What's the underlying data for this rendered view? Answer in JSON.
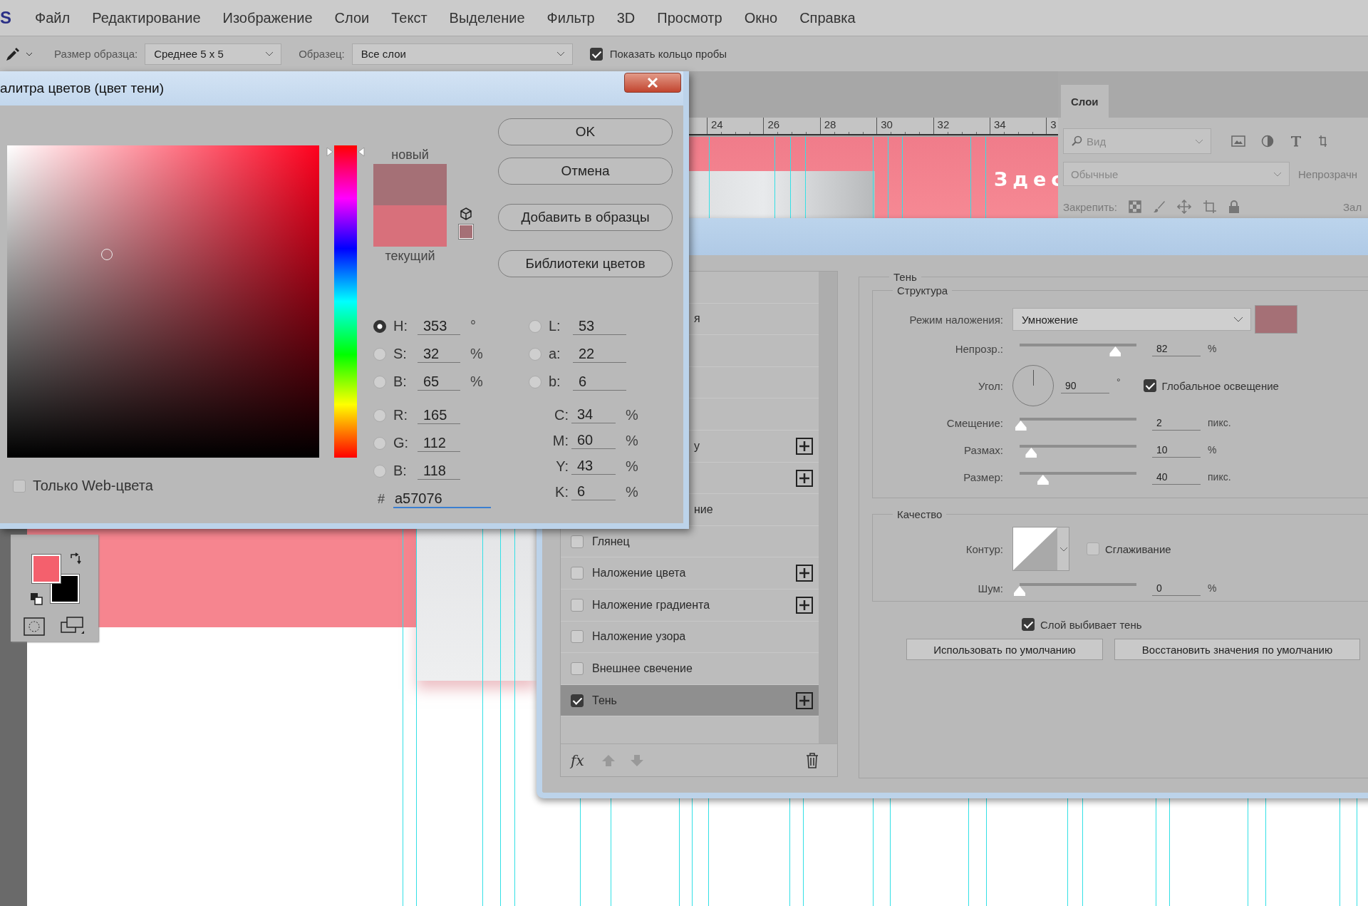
{
  "menu_bar": {
    "logo": "S",
    "items": [
      "Файл",
      "Редактирование",
      "Изображение",
      "Слои",
      "Текст",
      "Выделение",
      "Фильтр",
      "3D",
      "Просмотр",
      "Окно",
      "Справка"
    ]
  },
  "options_bar": {
    "sample_size_label": "Размер образца:",
    "sample_size": "Среднее 5 x 5",
    "sample_label": "Образец:",
    "sample": "Все слои",
    "sample_ring": {
      "label": "Показать кольцо пробы",
      "checked": true
    }
  },
  "document": {
    "ruler": [
      "24",
      "26",
      "28",
      "30",
      "32",
      "34",
      "3"
    ],
    "canvas_text": "Здес"
  },
  "layers_panel": {
    "tabs": [
      {
        "label": "Слои",
        "selected": true
      }
    ],
    "filter_placeholder": "Вид",
    "blend_mode": "Обычные",
    "opacity_label": "Непрозрачн",
    "lock_label": "Закрепить:",
    "fill_label": "Зал"
  },
  "toolbox": {
    "swatches": [
      {
        "kind": "foreground",
        "color": "#f4606d"
      },
      {
        "kind": "background",
        "color": "#000000"
      }
    ]
  },
  "color_picker": {
    "title": "алитра цветов (цвет тени)",
    "swatches": [
      {
        "label": "новый",
        "color": "#a57076"
      },
      {
        "label": "текущий",
        "color": "#d8707b"
      }
    ],
    "buttons": [
      "OK",
      "Отмена",
      "Добавить в образцы",
      "Библиотеки цветов"
    ],
    "hsb": [
      {
        "label": "H:",
        "value": "353",
        "unit": "°",
        "selected": true
      },
      {
        "label": "S:",
        "value": "32",
        "unit": "%",
        "selected": false
      },
      {
        "label": "B:",
        "value": "65",
        "unit": "%",
        "selected": false
      }
    ],
    "rgb": [
      {
        "label": "R:",
        "value": "165",
        "selected": false
      },
      {
        "label": "G:",
        "value": "112",
        "selected": false
      },
      {
        "label": "B:",
        "value": "118",
        "selected": false
      }
    ],
    "lab": [
      {
        "label": "L:",
        "value": "53",
        "selected": false
      },
      {
        "label": "a:",
        "value": "22",
        "selected": false
      },
      {
        "label": "b:",
        "value": "6",
        "selected": false
      }
    ],
    "cmyk": [
      {
        "label": "C:",
        "value": "34",
        "unit": "%"
      },
      {
        "label": "M:",
        "value": "60",
        "unit": "%"
      },
      {
        "label": "Y:",
        "value": "43",
        "unit": "%"
      },
      {
        "label": "K:",
        "value": "6",
        "unit": "%"
      }
    ],
    "hex_label": "#",
    "hex": "a57076",
    "web_only": {
      "label": "Только Web-цвета",
      "checked": false
    }
  },
  "layer_style": {
    "styles": [
      {
        "kind": "covered",
        "add_button": false,
        "selected": false
      },
      {
        "kind": "covered",
        "label": "я",
        "add_button": false,
        "selected": false
      },
      {
        "kind": "covered",
        "add_button": false,
        "selected": false
      },
      {
        "kind": "covered",
        "add_button": false,
        "selected": false
      },
      {
        "kind": "covered",
        "add_button": false,
        "selected": false
      },
      {
        "kind": "covered",
        "label": "у",
        "add_button": true,
        "selected": false
      },
      {
        "kind": "covered",
        "add_button": true,
        "selected": false
      },
      {
        "kind": "covered",
        "label": "ние",
        "add_button": false,
        "selected": false
      },
      {
        "kind": "effect",
        "label": "Глянец",
        "checked": false,
        "add_button": false,
        "selected": false
      },
      {
        "kind": "effect",
        "label": "Наложение цвета",
        "checked": false,
        "add_button": true,
        "selected": false
      },
      {
        "kind": "effect",
        "label": "Наложение градиента",
        "checked": false,
        "add_button": true,
        "selected": false
      },
      {
        "kind": "effect",
        "label": "Наложение узора",
        "checked": false,
        "add_button": false,
        "selected": false
      },
      {
        "kind": "effect",
        "label": "Внешнее свечение",
        "checked": false,
        "add_button": false,
        "selected": false
      },
      {
        "kind": "effect",
        "label": "Тень",
        "checked": true,
        "add_button": true,
        "selected": true
      }
    ],
    "fx_label": "fx",
    "shadow": {
      "title": "Тень",
      "structure": {
        "title": "Структура",
        "blend_label": "Режим наложения:",
        "blend_mode": "Умножение",
        "color": "#a57076",
        "rows": [
          {
            "kind": "slider",
            "label": "Непрозр.:",
            "value": "82",
            "unit": "%",
            "level": 0.82
          },
          {
            "kind": "angle",
            "label": "Угол:",
            "value": "90",
            "unit": "°",
            "global_light": {
              "label": "Глобальное освещение",
              "checked": true
            }
          },
          {
            "kind": "slider",
            "label": "Смещение:",
            "value": "2",
            "unit": "пикс.",
            "level": 0.01
          },
          {
            "kind": "slider",
            "label": "Размах:",
            "value": "10",
            "unit": "%",
            "level": 0.1
          },
          {
            "kind": "slider",
            "label": "Размер:",
            "value": "40",
            "unit": "пикс.",
            "level": 0.2
          }
        ]
      },
      "quality": {
        "title": "Качество",
        "contour_label": "Контур:",
        "anti_alias": {
          "label": "Сглаживание",
          "checked": false
        },
        "noise": {
          "label": "Шум:",
          "value": "0",
          "unit": "%",
          "level": 0
        }
      },
      "knockout": {
        "label": "Слой выбивает тень",
        "checked": true
      },
      "buttons": [
        "Использовать по умолчанию",
        "Восстановить значения по умолчанию"
      ]
    }
  }
}
